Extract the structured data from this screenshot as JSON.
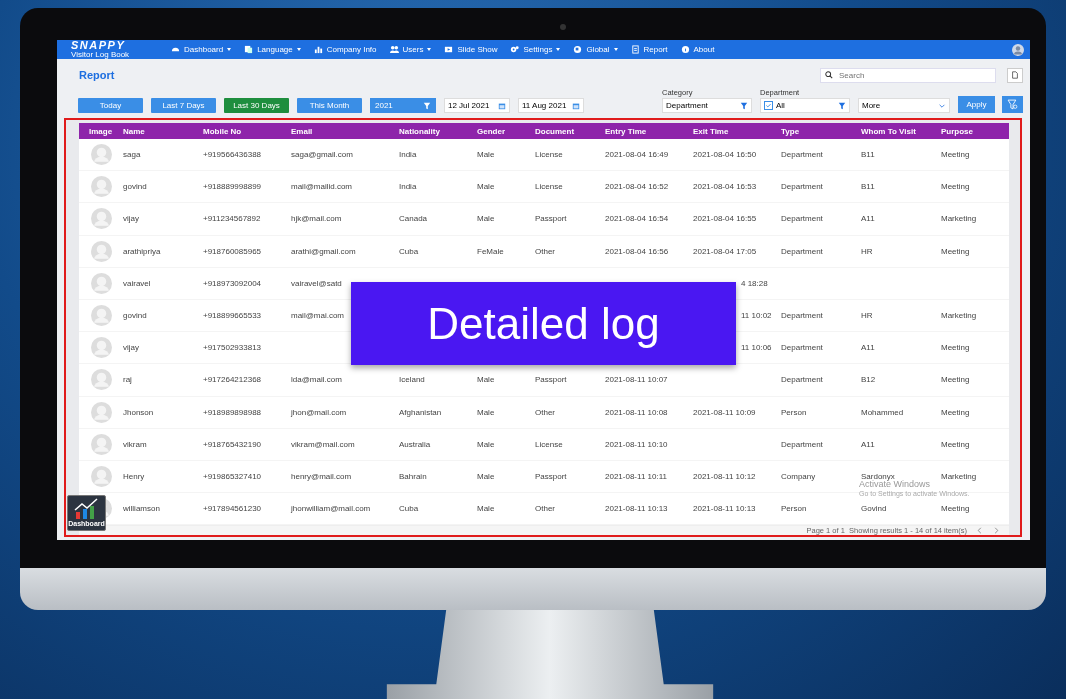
{
  "app": {
    "logo": "SNAPPY",
    "subtitle": "Visitor Log Book"
  },
  "menu": [
    {
      "label": "Dashboard",
      "dropdown": true
    },
    {
      "label": "Language",
      "dropdown": true
    },
    {
      "label": "Company Info",
      "dropdown": false
    },
    {
      "label": "Users",
      "dropdown": true
    },
    {
      "label": "Slide Show",
      "dropdown": false
    },
    {
      "label": "Settings",
      "dropdown": true
    },
    {
      "label": "Global",
      "dropdown": true
    },
    {
      "label": "Report",
      "dropdown": false
    },
    {
      "label": "About",
      "dropdown": false
    }
  ],
  "page_title": "Report",
  "search": {
    "placeholder": "Search"
  },
  "range_buttons": [
    {
      "label": "Today",
      "selected": false
    },
    {
      "label": "Last 7 Days",
      "selected": false
    },
    {
      "label": "Last 30 Days",
      "selected": true
    },
    {
      "label": "This Month",
      "selected": false
    }
  ],
  "year_select": "2021",
  "date_from": "12 Jul 2021",
  "date_to": "11 Aug 2021",
  "category": {
    "label": "Category",
    "value": "Department"
  },
  "department": {
    "label": "Department",
    "value": "All",
    "checked": true
  },
  "more_select": "More",
  "apply_button": "Apply",
  "columns": [
    "Image",
    "Name",
    "Mobile No",
    "Email",
    "Nationality",
    "Gender",
    "Document",
    "Entry Time",
    "Exit Time",
    "Type",
    "Whom To Visit",
    "Purpose"
  ],
  "rows": [
    {
      "name": "saga",
      "mobile": "+919566436388",
      "email": "saga@gmail.com",
      "nationality": "India",
      "gender": "Male",
      "document": "License",
      "entry": "2021-08-04 16:49",
      "exit": "2021-08-04 16:50",
      "type": "Department",
      "whom": "B11",
      "purpose": "Meeting"
    },
    {
      "name": "govind",
      "mobile": "+918889998899",
      "email": "mail@mailid.com",
      "nationality": "India",
      "gender": "Male",
      "document": "License",
      "entry": "2021-08-04 16:52",
      "exit": "2021-08-04 16:53",
      "type": "Department",
      "whom": "B11",
      "purpose": "Meeting"
    },
    {
      "name": "vijay",
      "mobile": "+911234567892",
      "email": "hjk@mail.com",
      "nationality": "Canada",
      "gender": "Male",
      "document": "Passport",
      "entry": "2021-08-04 16:54",
      "exit": "2021-08-04 16:55",
      "type": "Department",
      "whom": "A11",
      "purpose": "Marketing"
    },
    {
      "name": "arathipriya",
      "mobile": "+918760085965",
      "email": "arathi@gmail.com",
      "nationality": "Cuba",
      "gender": "FeMale",
      "document": "Other",
      "entry": "2021-08-04 16:56",
      "exit": "2021-08-04 17:05",
      "type": "Department",
      "whom": "HR",
      "purpose": "Meeting"
    },
    {
      "name": "vairavel",
      "mobile": "+918973092004",
      "email": "vairavel@satd",
      "exit": "4 18:28",
      "covered": true
    },
    {
      "name": "govind",
      "mobile": "+918899665533",
      "email": "mail@mai.com",
      "exit": "11 10:02",
      "type": "Department",
      "whom": "HR",
      "purpose": "Marketing",
      "covered": true
    },
    {
      "name": "vijay",
      "mobile": "+917502933813",
      "exit": "11 10:06",
      "type": "Department",
      "whom": "A11",
      "purpose": "Meeting",
      "covered": true
    },
    {
      "name": "raj",
      "mobile": "+917264212368",
      "email": "lda@mail.com",
      "nationality": "Iceland",
      "gender": "Male",
      "document": "Passport",
      "entry": "2021-08-11 10:07",
      "type": "Department",
      "whom": "B12",
      "purpose": "Meeting"
    },
    {
      "name": "Jhonson",
      "mobile": "+918989898988",
      "email": "jhon@mail.com",
      "nationality": "Afghanistan",
      "gender": "Male",
      "document": "Other",
      "entry": "2021-08-11 10:08",
      "exit": "2021-08-11 10:09",
      "type": "Person",
      "whom": "Mohammed",
      "purpose": "Meeting"
    },
    {
      "name": "vikram",
      "mobile": "+918765432190",
      "email": "vikram@mail.com",
      "nationality": "Australia",
      "gender": "Male",
      "document": "License",
      "entry": "2021-08-11 10:10",
      "type": "Department",
      "whom": "A11",
      "purpose": "Meeting"
    },
    {
      "name": "Henry",
      "mobile": "+919865327410",
      "email": "henry@mail.com",
      "nationality": "Bahrain",
      "gender": "Male",
      "document": "Passport",
      "entry": "2021-08-11 10:11",
      "exit": "2021-08-11 10:12",
      "type": "Company",
      "whom": "Sardonyx",
      "purpose": "Marketing"
    },
    {
      "name": "williamson",
      "mobile": "+917894561230",
      "email": "jhonwilliam@mail.com",
      "nationality": "Cuba",
      "gender": "Male",
      "document": "Other",
      "entry": "2021-08-11 10:13",
      "exit": "2021-08-11 10:13",
      "type": "Person",
      "whom": "Govind",
      "purpose": "Meeting"
    }
  ],
  "pagination": "Page 1 of 1  Showing results 1 - 14 of 14 item(s)",
  "os_notice": {
    "title": "Activate Windows",
    "hint": "Go to Settings to activate Windows."
  },
  "dashboard_shortcut": "Dashboard",
  "banner": "Detailed log"
}
